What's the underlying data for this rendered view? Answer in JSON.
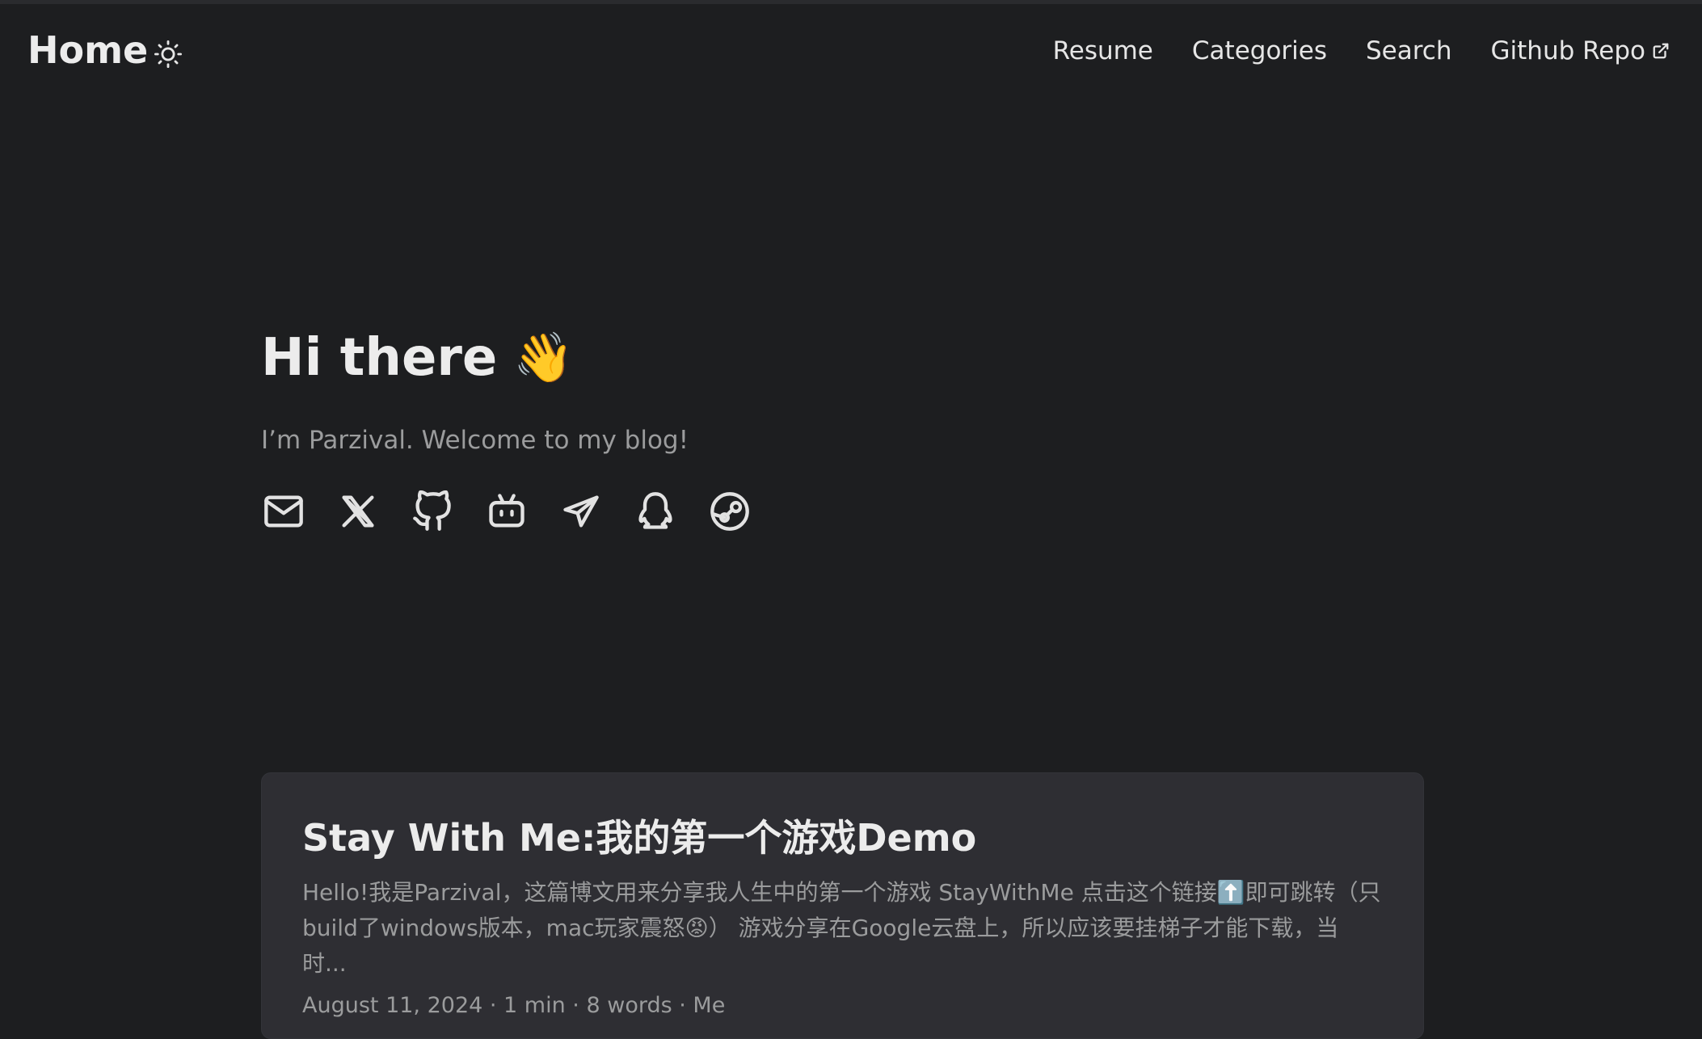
{
  "header": {
    "logo": "Home",
    "theme_icon": "sun-icon",
    "menu": [
      {
        "label": "Resume"
      },
      {
        "label": "Categories"
      },
      {
        "label": "Search"
      },
      {
        "label": "Github Repo",
        "icon": "external-link-icon"
      }
    ]
  },
  "hero": {
    "title": "Hi there",
    "emoji": "👋",
    "subtitle": "I’m Parzival. Welcome to my blog!"
  },
  "socials": [
    {
      "name": "mail-icon"
    },
    {
      "name": "x-icon"
    },
    {
      "name": "github-icon"
    },
    {
      "name": "bilibili-icon"
    },
    {
      "name": "telegram-icon"
    },
    {
      "name": "qq-icon"
    },
    {
      "name": "steam-icon"
    }
  ],
  "posts": [
    {
      "title": "Stay With Me:我的第一个游戏Demo",
      "summary_line1": "Hello!我是Parzival，这篇博文用来分享我人生中的第一个游戏 StayWithMe 点击这个链接⬆️即可跳转（只",
      "summary_line2": "build了windows版本，mac玩家震怒😡） 游戏分享在Google云盘上，所以应该要挂梯子才能下载，当时...",
      "meta": "August 11, 2024 · 1 min · 8 words · Me"
    }
  ],
  "colors": {
    "background": "#1d1e20",
    "card": "#2e2e33",
    "primary_text": "#dadadb",
    "secondary_text": "#9b9c9d"
  }
}
